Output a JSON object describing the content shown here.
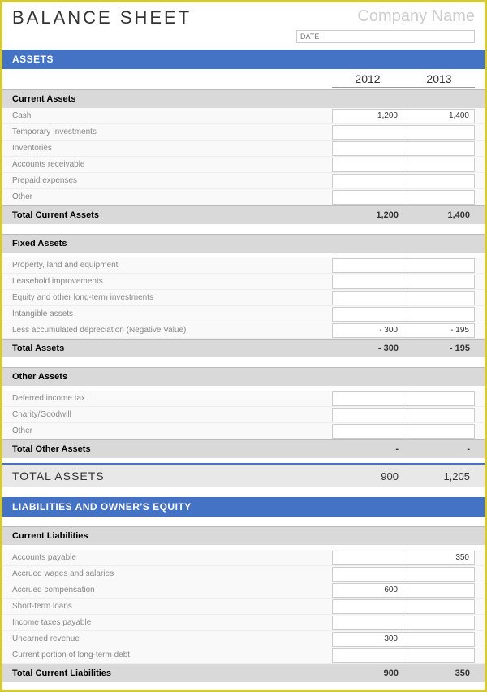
{
  "header": {
    "title": "BALANCE SHEET",
    "company": "Company Name",
    "date_placeholder": "DATE"
  },
  "years": {
    "y1": "2012",
    "y2": "2013"
  },
  "assets": {
    "title": "ASSETS",
    "current": {
      "title": "Current Assets",
      "rows": [
        {
          "label": "Cash",
          "v1": "1,200",
          "v2": "1,400"
        },
        {
          "label": "Temporary Investments",
          "v1": "",
          "v2": ""
        },
        {
          "label": "Inventories",
          "v1": "",
          "v2": ""
        },
        {
          "label": "Accounts receivable",
          "v1": "",
          "v2": ""
        },
        {
          "label": "Prepaid expenses",
          "v1": "",
          "v2": ""
        },
        {
          "label": "Other",
          "v1": "",
          "v2": ""
        }
      ],
      "total": {
        "label": "Total Current Assets",
        "v1": "1,200",
        "v2": "1,400"
      }
    },
    "fixed": {
      "title": "Fixed Assets",
      "rows": [
        {
          "label": "Property, land and equipment",
          "v1": "",
          "v2": ""
        },
        {
          "label": "Leasehold improvements",
          "v1": "",
          "v2": ""
        },
        {
          "label": "Equity and other long-term investments",
          "v1": "",
          "v2": ""
        },
        {
          "label": "Intangible assets",
          "v1": "",
          "v2": ""
        },
        {
          "label": "Less accumulated depreciation (Negative Value)",
          "v1": "- 300",
          "v2": "- 195"
        }
      ],
      "total": {
        "label": "Total Assets",
        "v1": "- 300",
        "v2": "- 195"
      }
    },
    "other": {
      "title": "Other Assets",
      "rows": [
        {
          "label": "Deferred income tax",
          "v1": "",
          "v2": ""
        },
        {
          "label": "Charity/Goodwill",
          "v1": "",
          "v2": ""
        },
        {
          "label": "Other",
          "v1": "",
          "v2": ""
        }
      ],
      "total": {
        "label": "Total Other Assets",
        "v1": "-",
        "v2": "-"
      }
    },
    "grand": {
      "label": "TOTAL ASSETS",
      "v1": "900",
      "v2": "1,205"
    }
  },
  "liabilities": {
    "title": "LIABILITIES AND OWNER'S EQUITY",
    "current": {
      "title": "Current Liabilities",
      "rows": [
        {
          "label": "Accounts payable",
          "v1": "",
          "v2": "350"
        },
        {
          "label": "Accrued wages and salaries",
          "v1": "",
          "v2": ""
        },
        {
          "label": "Accrued compensation",
          "v1": "600",
          "v2": ""
        },
        {
          "label": "Short-term loans",
          "v1": "",
          "v2": ""
        },
        {
          "label": "Income taxes payable",
          "v1": "",
          "v2": ""
        },
        {
          "label": "Unearned revenue",
          "v1": "300",
          "v2": ""
        },
        {
          "label": "Current portion of long-term debt",
          "v1": "",
          "v2": ""
        }
      ],
      "total": {
        "label": "Total Current Liabilities",
        "v1": "900",
        "v2": "350"
      }
    }
  }
}
